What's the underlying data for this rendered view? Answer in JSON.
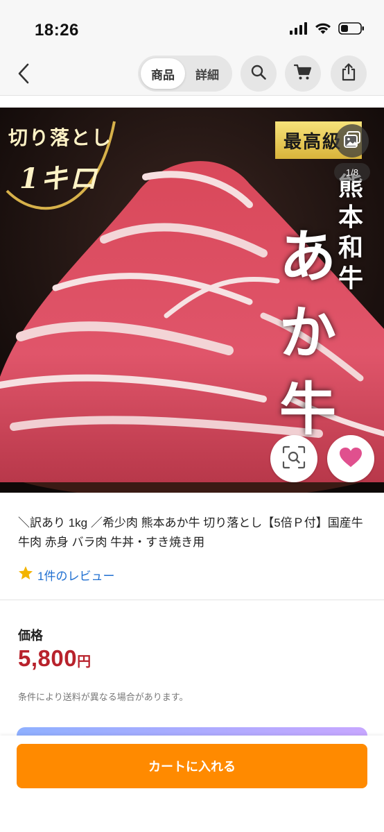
{
  "status_bar": {
    "time": "18:26",
    "icons": [
      "signal-icon",
      "wifi-icon",
      "battery-icon"
    ]
  },
  "nav": {
    "back_icon": "chevron-left-icon",
    "tabs": [
      {
        "label": "商品",
        "active": true
      },
      {
        "label": "詳細",
        "active": false
      }
    ],
    "actions": [
      "search-icon",
      "cart-icon",
      "share-icon"
    ]
  },
  "hero": {
    "badge_left_line1": "切り落とし",
    "badge_left_line2": "1キロ",
    "badge_right": "最高級",
    "vertical_text_small": "熊本和牛",
    "vertical_text_big": "あか牛",
    "page_indicator": "1/8",
    "gallery_icon": "image-gallery-icon",
    "lens_icon": "image-search-icon",
    "favorite_icon": "heart-icon"
  },
  "product": {
    "title": "＼訳あり 1kg ／希少肉 熊本あか牛 切り落とし【5倍Ｐ付】国産牛 牛肉 赤身 バラ肉 牛丼・すき焼き用",
    "review_text": "1件のレビュー",
    "rating_icon": "star-icon",
    "price_label": "価格",
    "price": "5,800",
    "price_unit": "円",
    "shipping_note": "条件により送料が異なる場合があります。"
  },
  "bottom": {
    "cart_button": "カートに入れる"
  },
  "colors": {
    "accent": "#ff8a00",
    "price": "#b8222c",
    "link": "#1f6fd1",
    "star": "#f3b400",
    "heart": "#e0508e"
  }
}
